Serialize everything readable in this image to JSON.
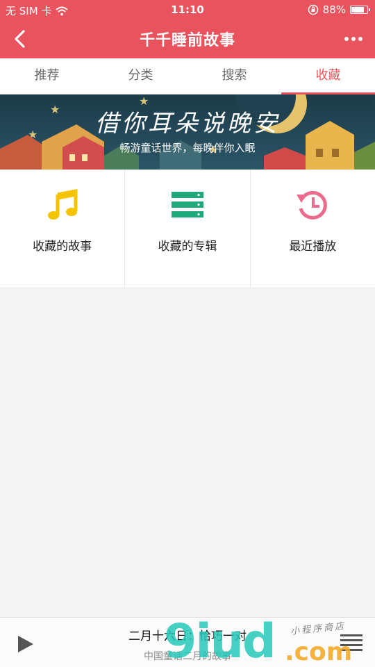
{
  "status_bar": {
    "carrier": "无 SIM 卡",
    "time": "11:10",
    "battery": "88%",
    "battery_level": 0.88
  },
  "nav": {
    "title": "千千睡前故事",
    "back_icon": "chevron-left-icon",
    "more_icon": "more-dots-icon"
  },
  "tabs": [
    {
      "label": "推荐",
      "active": false
    },
    {
      "label": "分类",
      "active": false
    },
    {
      "label": "搜索",
      "active": false
    },
    {
      "label": "收藏",
      "active": true
    }
  ],
  "banner": {
    "heading": "借你耳朵说晚安",
    "subheading": "畅游童话世界，每晚伴你入眠"
  },
  "features": [
    {
      "label": "收藏的故事",
      "icon": "music-note-icon",
      "color": "#f5c400"
    },
    {
      "label": "收藏的专辑",
      "icon": "album-list-icon",
      "color": "#1fa87a"
    },
    {
      "label": "最近播放",
      "icon": "history-icon",
      "color": "#ea6b8c"
    }
  ],
  "player": {
    "track": "二月十六日：恰巧一对",
    "album": "中国童话二月的故事",
    "play_icon": "play-icon",
    "list_icon": "playlist-icon"
  },
  "watermark": {
    "brand": "9iud",
    "suffix": ".com",
    "tagline": "小程序商店"
  },
  "colors": {
    "accent": "#e8535d",
    "background": "#f5f5f5"
  }
}
